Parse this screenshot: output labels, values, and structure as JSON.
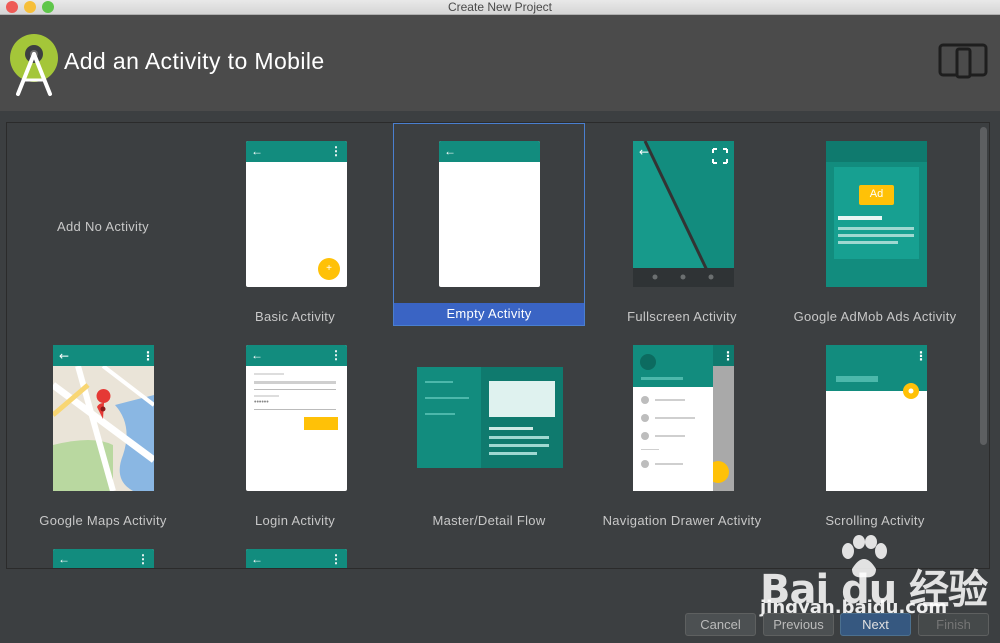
{
  "window": {
    "title": "Create New Project",
    "traffic_colors": [
      "#ee5b57",
      "#f6bf3a",
      "#5fc64a"
    ]
  },
  "header": {
    "title": "Add an Activity to Mobile",
    "brand_color": "#a4c639",
    "device_icon": "tablet-phone-icon"
  },
  "colors": {
    "appbar": "#128c7e",
    "accent_yellow": "#ffc107",
    "selection": "#3a64c4"
  },
  "templates": [
    {
      "id": "none",
      "label": "Add No Activity"
    },
    {
      "id": "basic",
      "label": "Basic Activity",
      "fab": "+"
    },
    {
      "id": "empty",
      "label": "Empty Activity",
      "selected": true
    },
    {
      "id": "fullscreen",
      "label": "Fullscreen Activity"
    },
    {
      "id": "admob",
      "label": "Google AdMob Ads Activity",
      "ad_badge": "Ad"
    },
    {
      "id": "maps",
      "label": "Google Maps Activity"
    },
    {
      "id": "login",
      "label": "Login Activity",
      "password_mask": "••••••"
    },
    {
      "id": "master",
      "label": "Master/Detail Flow"
    },
    {
      "id": "navdrawer",
      "label": "Navigation Drawer Activity"
    },
    {
      "id": "scrolling",
      "label": "Scrolling Activity"
    }
  ],
  "buttons": {
    "cancel": "Cancel",
    "previous": "Previous",
    "next": "Next",
    "finish": "Finish"
  },
  "watermark": {
    "brand": "Bai du 经验",
    "url": "jingyan.baidu.com"
  }
}
